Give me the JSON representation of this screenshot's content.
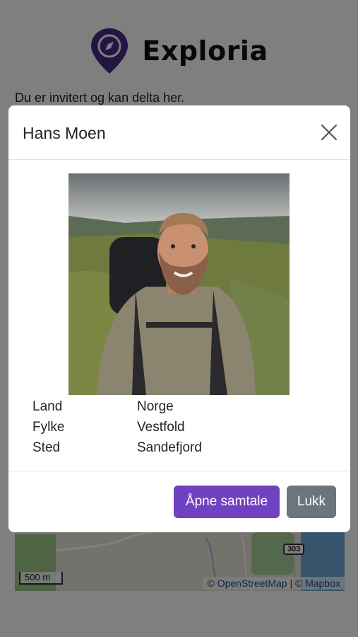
{
  "app": {
    "brand_name": "Exploria",
    "brand_color": "#4b2a85"
  },
  "page": {
    "invite_text": "Du er invitert og kan delta her."
  },
  "map": {
    "route_label": "303",
    "scale_label": "500 m",
    "attribution_prefix": "© ",
    "attribution_osm": "OpenStreetMap",
    "attribution_sep": " | © ",
    "attribution_mapbox": "Mapbox"
  },
  "modal": {
    "title": "Hans Moen",
    "close_icon": "close-icon",
    "photo_alt": "Hans Moen",
    "info": [
      {
        "label": "Land",
        "value": "Norge"
      },
      {
        "label": "Fylke",
        "value": "Vestfold"
      },
      {
        "label": "Sted",
        "value": "Sandefjord"
      }
    ],
    "primary_button": "Åpne samtale",
    "secondary_button": "Lukk",
    "primary_color": "#6f42c1",
    "secondary_color": "#6c757d"
  }
}
